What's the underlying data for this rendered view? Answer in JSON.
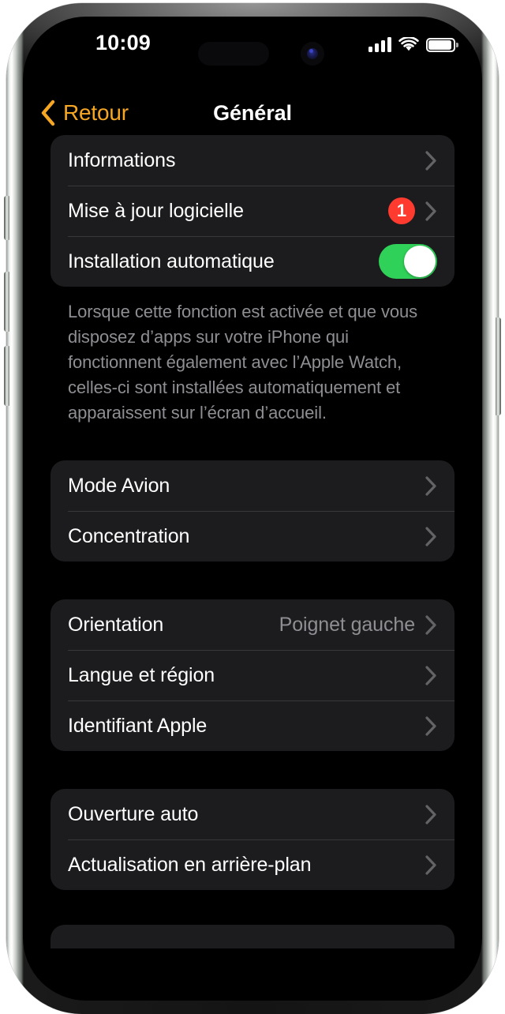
{
  "status_bar": {
    "time": "10:09",
    "cellular_icon": "cellular-bars-icon",
    "wifi_icon": "wifi-icon",
    "battery_icon": "battery-full-icon"
  },
  "nav": {
    "back_label": "Retour",
    "back_icon": "chevron-left-icon",
    "title": "Général"
  },
  "colors": {
    "accent": "#F5A623",
    "badge": "#FF3B30",
    "toggle_on": "#30D158",
    "card": "#1C1C1E",
    "separator": "#38383A",
    "secondary_text": "#8E8E93",
    "screen_background": "#000000"
  },
  "groups": [
    {
      "rows": [
        {
          "label": "Informations",
          "type": "disclosure",
          "chevron_icon": "chevron-right-icon"
        },
        {
          "label": "Mise à jour logicielle",
          "type": "disclosure",
          "badge": "1",
          "chevron_icon": "chevron-right-icon"
        },
        {
          "label": "Installation automatique",
          "type": "toggle",
          "toggle_state": "on"
        }
      ],
      "footer": "Lorsque cette fonction est activée et que vous disposez d’apps sur votre iPhone qui fonctionnent également avec l’Apple Watch, celles-ci sont installées automatiquement et apparaissent sur l’écran d’accueil."
    },
    {
      "rows": [
        {
          "label": "Mode Avion",
          "type": "disclosure",
          "chevron_icon": "chevron-right-icon"
        },
        {
          "label": "Concentration",
          "type": "disclosure",
          "chevron_icon": "chevron-right-icon"
        }
      ]
    },
    {
      "rows": [
        {
          "label": "Orientation",
          "type": "disclosure",
          "value": "Poignet gauche",
          "chevron_icon": "chevron-right-icon"
        },
        {
          "label": "Langue et région",
          "type": "disclosure",
          "chevron_icon": "chevron-right-icon"
        },
        {
          "label": "Identifiant Apple",
          "type": "disclosure",
          "chevron_icon": "chevron-right-icon"
        }
      ]
    },
    {
      "rows": [
        {
          "label": "Ouverture auto",
          "type": "disclosure",
          "chevron_icon": "chevron-right-icon"
        },
        {
          "label": "Actualisation en arrière-plan",
          "type": "disclosure",
          "chevron_icon": "chevron-right-icon"
        }
      ]
    }
  ]
}
